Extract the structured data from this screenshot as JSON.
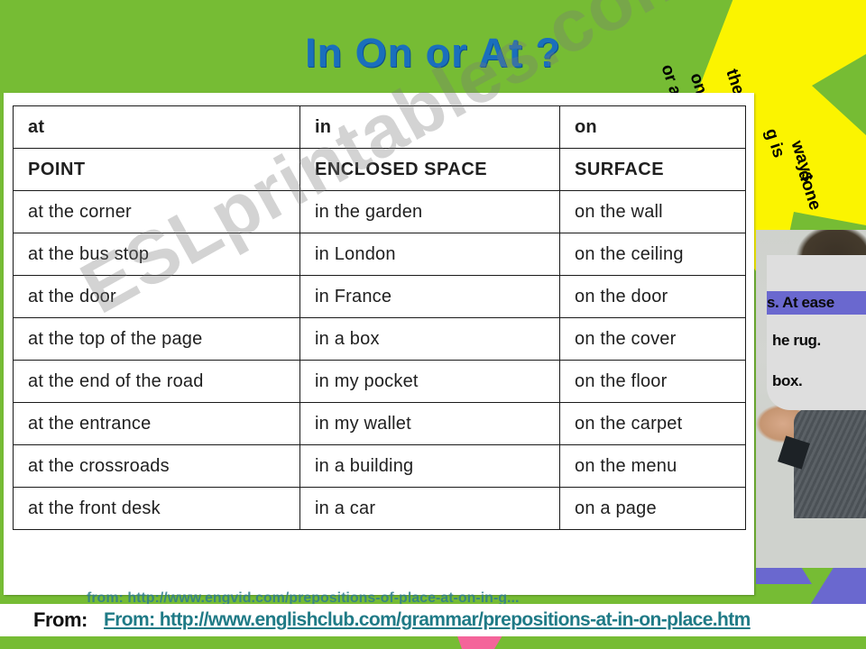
{
  "slide": {
    "title": "In On  or At ?",
    "background_color": "#76bc34",
    "title_color": "#1a6fbd",
    "accent_yellow": "#fbf400",
    "accent_purple": "#6a68cf",
    "accent_pink": "#f4649a"
  },
  "watermark": {
    "text": "ESLprintables.com"
  },
  "table": {
    "headers": [
      "at",
      "in",
      "on"
    ],
    "categories": [
      "POINT",
      "ENCLOSED SPACE",
      "SURFACE"
    ],
    "rows": [
      [
        "at the corner",
        "in the garden",
        "on the wall"
      ],
      [
        "at the bus stop",
        "in London",
        "on the ceiling"
      ],
      [
        "at the door",
        "in France",
        "on the door"
      ],
      [
        "at the top of the page",
        "in a box",
        "on the cover"
      ],
      [
        "at the end of the road",
        "in my pocket",
        "on the floor"
      ],
      [
        "at the entrance",
        "in my wallet",
        "on the carpet"
      ],
      [
        "at the crossroads",
        "in a building",
        "on the menu"
      ],
      [
        "at the front desk",
        "in a car",
        "on a page"
      ]
    ]
  },
  "burst": {
    "lines": [
      "or a",
      "on",
      "the",
      "g is",
      "ways",
      "done"
    ]
  },
  "info_card": {
    "lines": [
      {
        "text": "s. At ease",
        "highlight": true
      },
      {
        "text": "he rug.",
        "highlight": false
      },
      {
        "text": "box.",
        "highlight": false
      }
    ]
  },
  "source_behind": {
    "text": "from: http://www.engvid.com/prepositions-of-place-at-on-in-g..."
  },
  "footer": {
    "from_label": "From:",
    "link_text": "From: http://www.englishclub.com/grammar/prepositions-at-in-on-place.htm"
  }
}
